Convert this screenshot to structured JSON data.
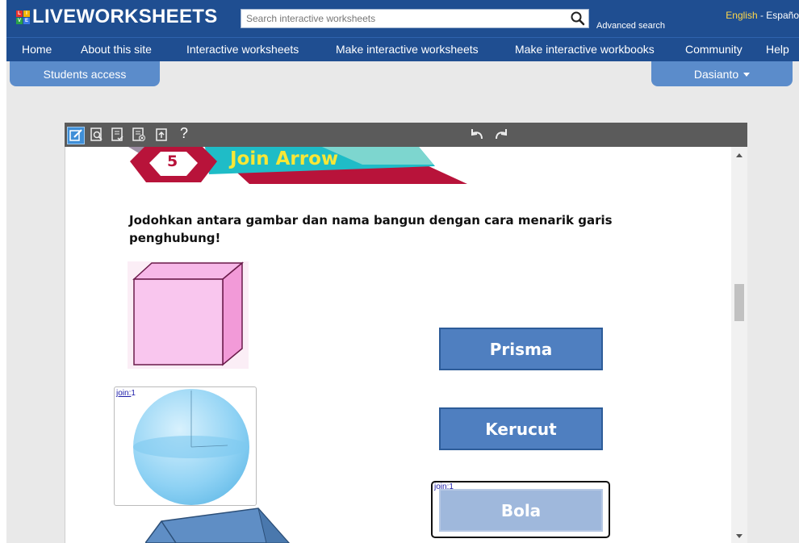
{
  "header": {
    "logo_text": "LIVEWORKSHEETS",
    "logo_letters": [
      "L",
      "I",
      "V",
      "E"
    ],
    "search_placeholder": "Search interactive worksheets",
    "advanced_search": "Advanced search",
    "lang_english": "English",
    "lang_sep": " - ",
    "lang_spanish": "Españo"
  },
  "nav": {
    "items": [
      {
        "label": "Home"
      },
      {
        "label": "About this site"
      },
      {
        "label": "Interactive worksheets"
      },
      {
        "label": "Make interactive worksheets"
      },
      {
        "label": "Make interactive workbooks"
      },
      {
        "label": "Community"
      },
      {
        "label": "Help"
      }
    ]
  },
  "tabs": {
    "students": "Students access",
    "user": "Dasianto"
  },
  "toolbar": {
    "icons": [
      "edit-icon",
      "preview-icon",
      "check-answers-icon",
      "clear-answers-icon",
      "upload-icon"
    ],
    "help": "?"
  },
  "worksheet": {
    "banner_number": "5",
    "banner_title": "Join Arrow",
    "instruction": "Jodohkan antara gambar dan nama bangun dengan cara menarik garis penghubung!",
    "join_label": "join:",
    "join_number": "1",
    "bola_join_label": "join:1",
    "answers": {
      "prisma": "Prisma",
      "kerucut": "Kerucut",
      "bola": "Bola"
    }
  },
  "colors": {
    "topbar": "#1f4e91",
    "tab": "#5b8ccb",
    "english": "#ffd84a",
    "answer_btn": "#4f7fc0",
    "answer_btn_selected": "#9fb8dc",
    "banner_red": "#b8133a",
    "banner_teal": "#1fbcc7"
  }
}
